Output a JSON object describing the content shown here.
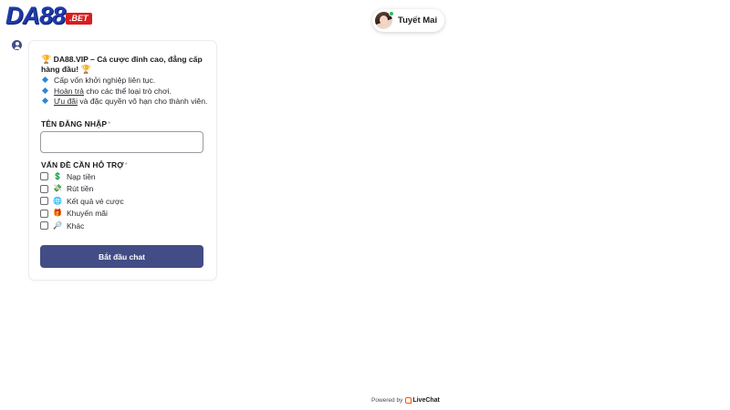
{
  "brand": {
    "logo_main": "DA88",
    "logo_tld": ".BET",
    "colors": {
      "logo": "#1f3aa8",
      "tld_bg": "#d81e1e",
      "accent": "#424d86",
      "bullet": "#2f86d6"
    }
  },
  "agent": {
    "name": "Tuyết Mai",
    "status": "online"
  },
  "intro": {
    "title": "DA88.VIP – Cá cược đỉnh cao, đẳng cấp hàng đầu!",
    "trophy_icon": "🏆",
    "bullets": [
      {
        "underlined": "",
        "text": "Cấp vốn khởi nghiệp liên tục."
      },
      {
        "underlined": "Hoàn trả",
        "text": " cho các thể loại trò chơi."
      },
      {
        "underlined": "Ưu đãi",
        "text": " và đặc quyền vô hạn cho thành viên."
      }
    ]
  },
  "form": {
    "username_label": "TÊN ĐĂNG NHẬP",
    "required_mark": "*",
    "username_value": "",
    "issue_label": "VẤN ĐỀ CẦN HỖ TRỢ",
    "options": [
      {
        "icon": "💲",
        "icon_name": "dollar-icon",
        "label": "Nạp tiền",
        "checked": false
      },
      {
        "icon": "💸",
        "icon_name": "money-withdraw-icon",
        "label": "Rút tiền",
        "checked": false
      },
      {
        "icon": "🌐",
        "icon_name": "globe-icon",
        "label": "Kết quả vé cược",
        "checked": false
      },
      {
        "icon": "🎁",
        "icon_name": "gift-icon",
        "label": "Khuyến mãi",
        "checked": false
      },
      {
        "icon": "🔎",
        "icon_name": "magnifier-icon",
        "label": "Khác",
        "checked": false
      }
    ],
    "submit_label": "Bắt đầu chat"
  },
  "footer": {
    "powered_by": "Powered by",
    "brand": "LiveChat"
  }
}
